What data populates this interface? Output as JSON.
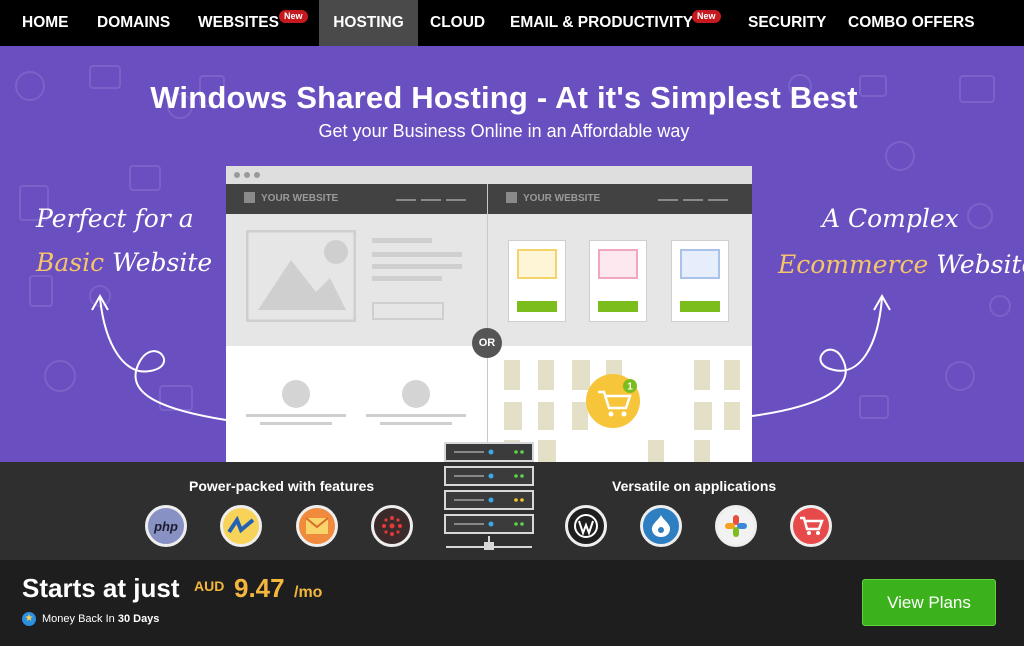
{
  "nav": {
    "items": [
      "HOME",
      "DOMAINS",
      "WEBSITES",
      "HOSTING",
      "CLOUD",
      "EMAIL & PRODUCTIVITY",
      "SECURITY",
      "COMBO OFFERS"
    ],
    "badge": "New",
    "active": "HOSTING"
  },
  "hero": {
    "title": "Windows Shared Hosting - At it's Simplest Best",
    "subtitle": "Get your Business Online in an Affordable way",
    "left_script_line1": "Perfect for a",
    "left_script_accent": "Basic",
    "left_script_word": "Website",
    "right_script_line1": "A Complex",
    "right_script_accent": "Ecommerce",
    "right_script_word": "Website",
    "mock_label": "YOUR WEBSITE",
    "or_label": "OR",
    "cart_count": "1"
  },
  "features": {
    "left_title": "Power-packed with features",
    "right_title": "Versatile on applications",
    "php_label": "php",
    "left_icons": [
      "php-icon",
      "dotnet-icon",
      "email-icon",
      "ruby-icon"
    ],
    "right_icons": [
      "wordpress-icon",
      "drupal-icon",
      "joomla-icon",
      "shopping-cart-icon"
    ]
  },
  "pricing": {
    "starts_label": "Starts at just",
    "currency": "AUD",
    "price": "9.47",
    "period": "/mo",
    "money_back_prefix": "Money Back In",
    "money_back_days": "30 Days",
    "cta": "View Plans"
  },
  "colors": {
    "hero_bg": "#6a4fc0",
    "accent_gold": "#f4b73e",
    "cta_green": "#3bb21c",
    "badge_red": "#c4191f"
  }
}
